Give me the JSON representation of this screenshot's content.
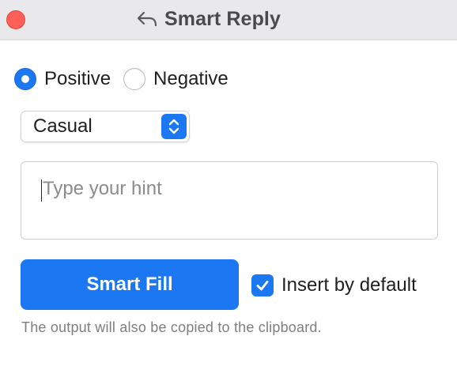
{
  "window": {
    "title": "Smart Reply",
    "title_icon": "reply-icon",
    "accent_color": "#1b78f2"
  },
  "sentiment": {
    "options": [
      {
        "label": "Positive",
        "selected": true
      },
      {
        "label": "Negative",
        "selected": false
      }
    ]
  },
  "tone": {
    "selected": "Casual"
  },
  "hint": {
    "value": "",
    "placeholder": "Type your hint"
  },
  "actions": {
    "smart_fill_label": "Smart Fill",
    "insert_default_label": "Insert by default",
    "insert_default_checked": true
  },
  "footnote": "The output will also be copied to the clipboard."
}
